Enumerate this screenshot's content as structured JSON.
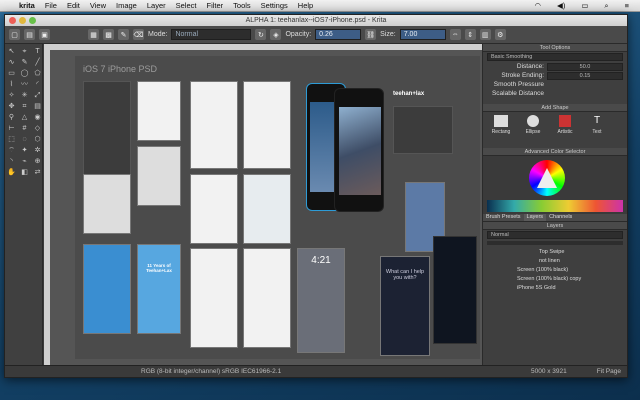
{
  "menubar": {
    "app": "krita",
    "items": [
      "File",
      "Edit",
      "View",
      "Image",
      "Layer",
      "Select",
      "Filter",
      "Tools",
      "Settings",
      "Help"
    ]
  },
  "window": {
    "title": "ALPHA 1: teehanlax--iOS7-iPhone.psd - Krita"
  },
  "toolbar": {
    "mode_label": "Mode:",
    "mode_value": "Normal",
    "opacity_label": "Opacity:",
    "opacity_value": "0.26",
    "size_label": "Size:",
    "size_value": "7.00"
  },
  "canvas": {
    "doc_title": "iOS 7 iPhone PSD",
    "brand": "teehan+lax",
    "phone_time": "4:21",
    "siri_text": "What can I help you with?",
    "cell_title": "11 Years of Teehan+Lax"
  },
  "tool_options": {
    "title": "Tool Options",
    "smoothing": "Basic Smoothing",
    "rows": [
      {
        "label": "Distance:",
        "value": "50.0"
      },
      {
        "label": "Stroke Ending:",
        "value": "0.15"
      },
      {
        "label": "Smooth Pressure",
        "value": ""
      },
      {
        "label": "Scalable Distance",
        "value": ""
      }
    ]
  },
  "add_shape": {
    "title": "Add Shape",
    "items": [
      "Rectang",
      "Ellipse",
      "Artistic",
      "Text"
    ]
  },
  "color_selector": {
    "title": "Advanced Color Selector"
  },
  "layers": {
    "tabs": [
      "Brush Presets",
      "Layers",
      "Channels"
    ],
    "title": "Layers",
    "blend": "Normal",
    "items": [
      "Top Swipe",
      "not linen",
      "Screen (100% black)",
      "Screen (100% black) copy",
      "iPhone 5S Gold"
    ]
  },
  "status": {
    "color": "RGB (8-bit integer/channel)  sRGB IEC61966-2.1",
    "dimensions": "5000 x 3921",
    "zoom": "Fit Page"
  }
}
